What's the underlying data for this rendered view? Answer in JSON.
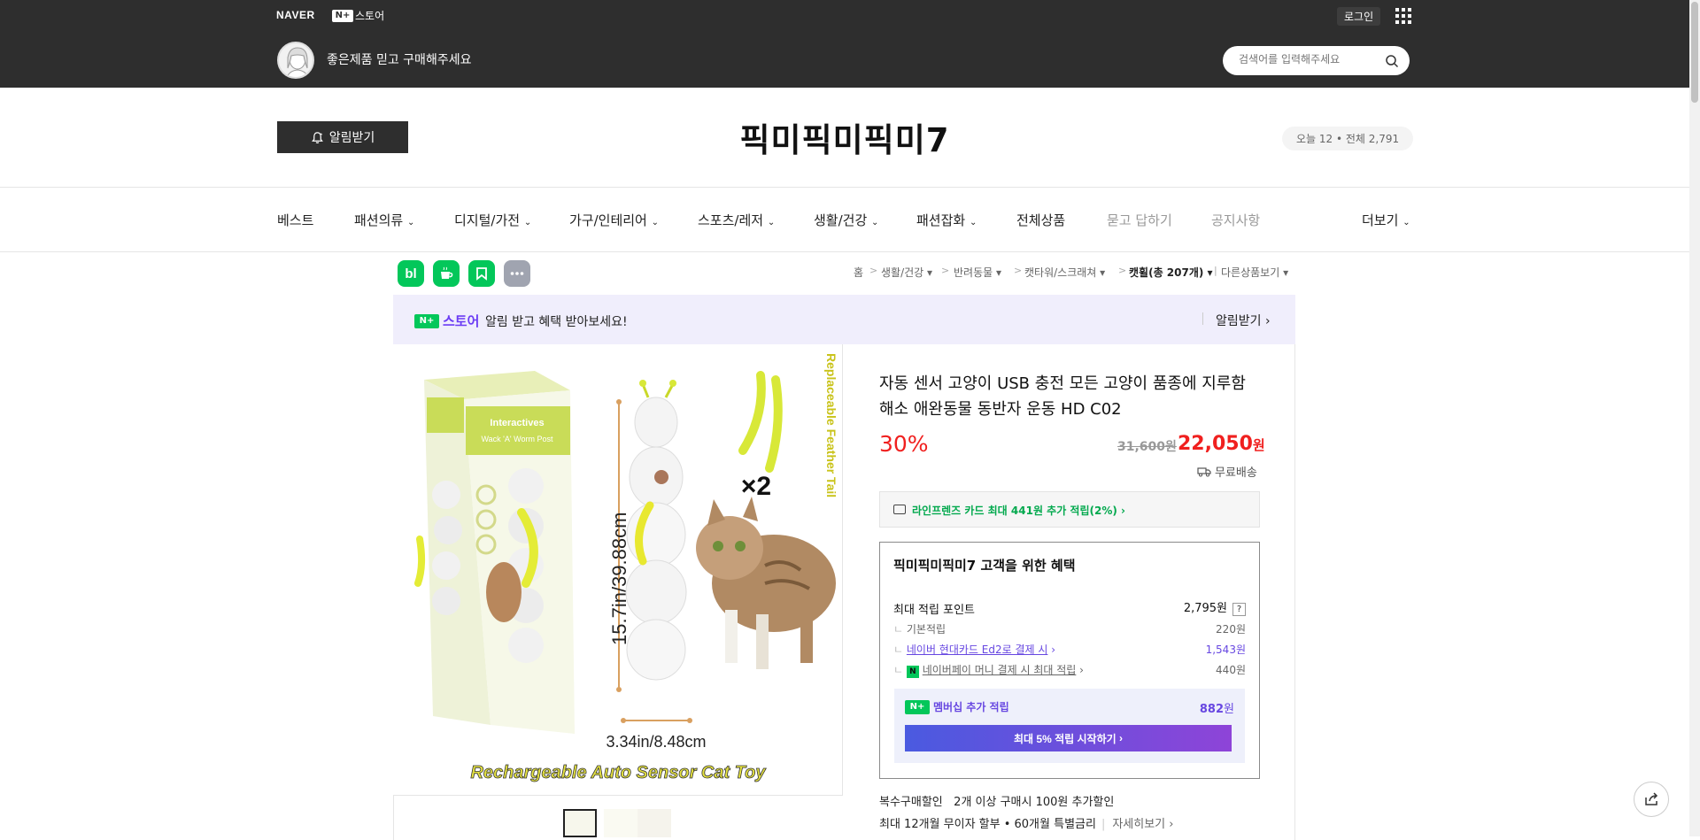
{
  "top_header": {
    "naver_logo": "NAVER",
    "store_logo_box": "N+",
    "store_logo_text": "스토어",
    "login": "로그인",
    "tagline": "좋은제품 믿고 구매해주세요",
    "search_placeholder": "검색어를 입력해주세요"
  },
  "store_header": {
    "alarm_button": "알림받기",
    "title": "픽미픽미픽미7",
    "visitors": "오늘 12 • 전체 2,791"
  },
  "nav": {
    "items": [
      "베스트",
      "패션의류",
      "디지털/가전",
      "가구/인테리어",
      "스포츠/레저",
      "생활/건강",
      "패션잡화",
      "전체상품",
      "묻고 답하기",
      "공지사항",
      "더보기"
    ]
  },
  "share_icons": [
    "bl",
    "cafe-icon",
    "bookmark-icon",
    "more-icon"
  ],
  "breadcrumb": {
    "items": [
      "홈",
      "생활/건강",
      "반려동물",
      "캣타워/스크래쳐",
      "캣휠(총 207개)",
      "다른상품보기"
    ]
  },
  "promo": {
    "logo_box": "N+",
    "logo_text": "스토어",
    "text": "알림 받고 혜택 받아보세요!",
    "link": "알림받기"
  },
  "product": {
    "image_texts": {
      "height_label": "15.7in/39.88cm",
      "width_label": "3.34in/8.48cm",
      "multiplier": "×2",
      "side_text": "Replaceable Feather Tail",
      "bottom_text": "Rechargeable Auto Sensor Cat Toy",
      "box_brand": "Interactives",
      "box_text": "Wack 'A' Worm Post"
    },
    "title": "자동 센서 고양이 USB 충전 모든 고양이 품종에 지루함 해소 애완동물 동반자 운동 HD C02",
    "discount": "30%",
    "original_price": "31,600원",
    "price": "22,050",
    "price_unit": "원",
    "shipping": "무료배송",
    "card_benefit": "라인프렌즈 카드 최대 441원 추가 적립(2%)"
  },
  "benefits": {
    "heading": "픽미픽미픽미7 고객을 위한 혜택",
    "max_points_label": "최대 적립 포인트",
    "max_points_value": "2,795원",
    "help": "?",
    "rows": [
      {
        "label": "기본적립",
        "value": "220원"
      },
      {
        "label": "네이버 현대카드 Ed2로 결제 시",
        "value": "1,543원"
      },
      {
        "label": "네이버페이 머니 결제 시 최대 적립",
        "value": "440원"
      }
    ],
    "npay_icon": "N",
    "membership_label": "멤버십 추가 적립",
    "membership_value": "882",
    "membership_unit": "원",
    "membership_button": "최대 5% 적립 시작하기"
  },
  "multi_purchase": {
    "label": "복수구매할인",
    "text": "2개 이상 구매시 100원 추가할인"
  },
  "installment": {
    "text": "최대 12개월 무이자 할부 • 60개월 특별금리",
    "more": "자세히보기"
  }
}
